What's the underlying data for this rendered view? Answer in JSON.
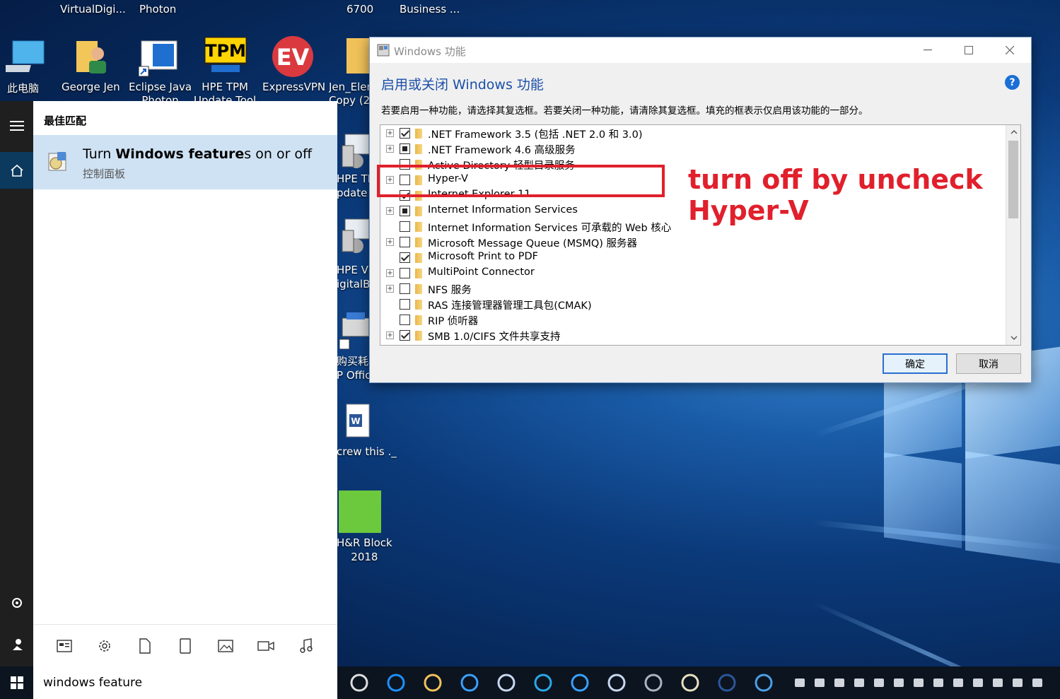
{
  "desktop": {
    "top_labels": [
      "VirtualDigi...",
      "Photon",
      "6700",
      "Business ..."
    ],
    "icons": [
      {
        "label": "此电脑",
        "icon": "computer-icon"
      },
      {
        "label": "George Jen",
        "icon": "user-folder-icon"
      },
      {
        "label": "Eclipse Java\nPhoton",
        "icon": "shortcut-icon"
      },
      {
        "label": "HPE TPM\nUpdate Tool",
        "icon": "tpm-icon"
      },
      {
        "label": "ExpressVPN",
        "icon": "expressvpn-icon"
      },
      {
        "label": "Jen_Elen\nCopy (2",
        "icon": "folder-icon"
      }
    ],
    "column_labels": [
      {
        "label": "HPE TI\npdate",
        "icon": "install-icon"
      },
      {
        "label": "HPE Vir\nigitalB",
        "icon": "install-icon"
      },
      {
        "label": "购买耗材\nP Offic",
        "icon": "printer-icon"
      },
      {
        "label": "crew this ._",
        "icon": "word-doc-icon"
      },
      {
        "label": "H&R Block\n2018",
        "icon": "hr-block-icon"
      }
    ]
  },
  "start_menu": {
    "best_match_label": "最佳匹配",
    "result_title_pre": "Turn ",
    "result_title_bold": "Windows feature",
    "result_title_post": "s on or off",
    "result_subtitle": "控制面板",
    "filter_icons": [
      "apps-filter-icon",
      "settings-filter-icon",
      "documents-filter-icon",
      "tablet-filter-icon",
      "photos-filter-icon",
      "videos-filter-icon",
      "music-filter-icon"
    ]
  },
  "search": {
    "value": "windows feature"
  },
  "dialog": {
    "title": "Windows 功能",
    "heading": "启用或关闭 Windows 功能",
    "help": "?",
    "description": "若要启用一种功能，请选择其复选框。若要关闭一种功能，请清除其复选框。填充的框表示仅启用该功能的一部分。",
    "features": [
      {
        "label": ".NET Framework 3.5 (包括 .NET 2.0 和 3.0)",
        "state": "checked",
        "expandable": true
      },
      {
        "label": ".NET Framework 4.6 高级服务",
        "state": "partial",
        "expandable": true
      },
      {
        "label": "Active Directory 轻型目录服务",
        "state": "unchecked",
        "expandable": false
      },
      {
        "label": "Hyper-V",
        "state": "unchecked",
        "expandable": true
      },
      {
        "label": "Internet Explorer 11",
        "state": "checked",
        "expandable": false
      },
      {
        "label": "Internet Information Services",
        "state": "partial",
        "expandable": true
      },
      {
        "label": "Internet Information Services 可承载的 Web 核心",
        "state": "unchecked",
        "expandable": false
      },
      {
        "label": "Microsoft Message Queue (MSMQ) 服务器",
        "state": "unchecked",
        "expandable": true
      },
      {
        "label": "Microsoft Print to PDF",
        "state": "checked",
        "expandable": false
      },
      {
        "label": "MultiPoint Connector",
        "state": "unchecked",
        "expandable": true
      },
      {
        "label": "NFS 服务",
        "state": "unchecked",
        "expandable": true
      },
      {
        "label": "RAS 连接管理器管理工具包(CMAK)",
        "state": "unchecked",
        "expandable": false
      },
      {
        "label": "RIP 侦听器",
        "state": "unchecked",
        "expandable": false
      },
      {
        "label": "SMB 1.0/CIFS 文件共享支持",
        "state": "checked",
        "expandable": true
      }
    ],
    "ok_label": "确定",
    "cancel_label": "取消"
  },
  "annotation": {
    "text": "turn off by uncheck\nHyper-V",
    "color": "#e0202c"
  },
  "taskbar": {
    "icons": [
      "task-view-icon",
      "edge-icon",
      "file-explorer-icon",
      "ie-icon",
      "cortana-icon",
      "skype-icon",
      "ie-icon",
      "cortana-icon",
      "app-icon",
      "paint-icon",
      "word-icon",
      "remote-desktop-icon"
    ],
    "tray_icons": [
      "network-icon",
      "printer-tray-icon",
      "onedrive-icon",
      "dollar-icon",
      "java-icon",
      "shield-icon",
      "orange-app-icon",
      "circle-tray-icon",
      "capture-icon",
      "tools-icon",
      "ime-icon",
      "skype-tray-icon",
      "more-icon"
    ]
  }
}
